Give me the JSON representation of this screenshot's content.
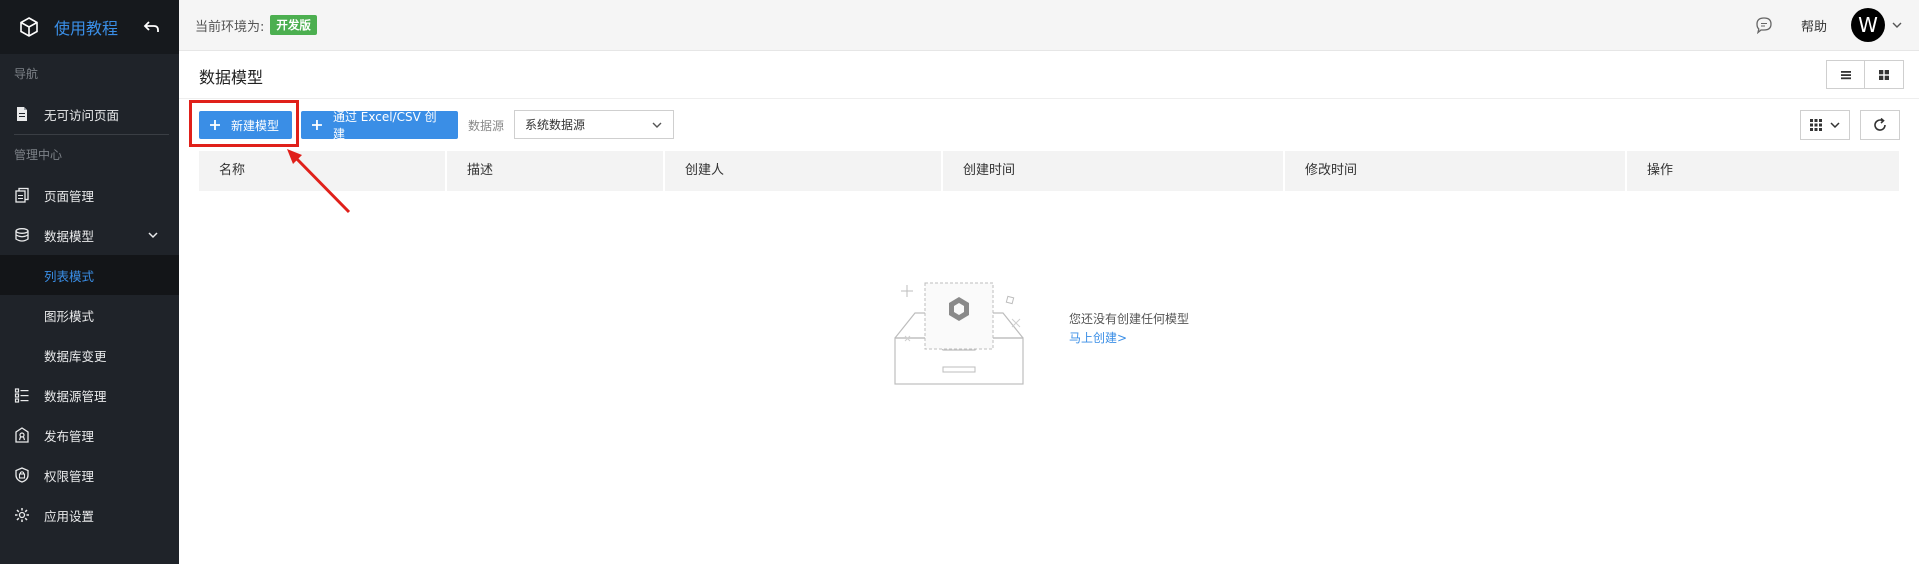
{
  "sidebar": {
    "app_title": "使用教程",
    "groups": {
      "nav": "导航",
      "admin": "管理中心"
    },
    "nav_items": [
      {
        "label": "无可访问页面",
        "icon": "file-icon"
      }
    ],
    "admin_items": [
      {
        "label": "页面管理",
        "icon": "pages-icon"
      },
      {
        "label": "数据模型",
        "icon": "database-icon"
      },
      {
        "label": "数据源管理",
        "icon": "datasource-icon"
      },
      {
        "label": "发布管理",
        "icon": "publish-icon"
      },
      {
        "label": "权限管理",
        "icon": "shield-icon"
      },
      {
        "label": "应用设置",
        "icon": "gear-icon"
      }
    ],
    "data_model_sub": [
      {
        "label": "列表模式",
        "active": true
      },
      {
        "label": "图形模式",
        "active": false
      },
      {
        "label": "数据库变更",
        "active": false
      }
    ]
  },
  "topbar": {
    "env_label": "当前环境为:",
    "env_badge": "开发版",
    "help": "帮助",
    "avatar_letter": "W"
  },
  "page": {
    "title": "数据模型"
  },
  "toolbar": {
    "new_model": "新建模型",
    "import": "通过 Excel/CSV 创建",
    "datasource_label": "数据源",
    "datasource_value": "系统数据源"
  },
  "table": {
    "columns": [
      "名称",
      "描述",
      "创建人",
      "创建时间",
      "修改时间",
      "操作"
    ],
    "rows": []
  },
  "empty": {
    "message": "您还没有创建任何模型",
    "link": "马上创建>"
  },
  "colors": {
    "accent": "#3a8ee6",
    "sidebar_bg": "#1f2329",
    "env_badge": "#4caf50",
    "highlight": "#e0201a"
  }
}
